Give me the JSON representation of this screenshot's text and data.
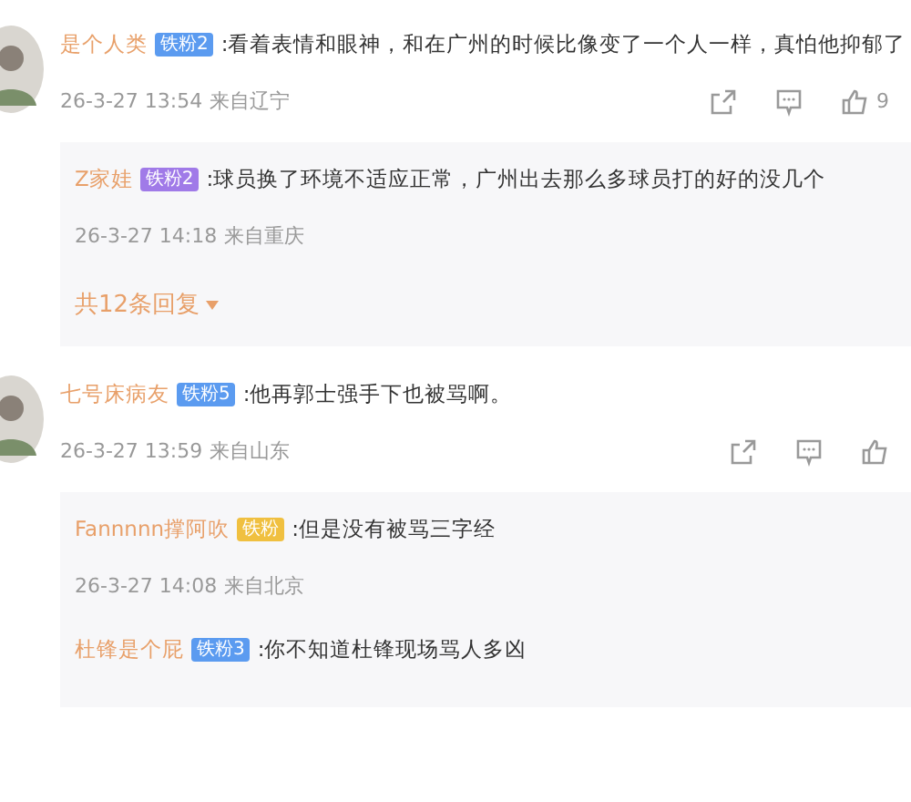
{
  "comments": [
    {
      "user": "是个人类",
      "badge": {
        "label": "铁粉2",
        "color": "#5b9bf0"
      },
      "text": ":看着表情和眼神，和在广州的时候比像变了一个人一样，真怕他抑郁了",
      "time": "26-3-27 13:54",
      "location": "来自辽宁",
      "likes": "9",
      "replies": [
        {
          "user": "Z家娃",
          "badge": {
            "label": "铁粉2",
            "color": "#a07ae8"
          },
          "text": ":球员换了环境不适应正常，广州出去那么多球员打的好的没几个",
          "time": "26-3-27 14:18",
          "location": "来自重庆"
        }
      ],
      "more_replies": "共12条回复"
    },
    {
      "user": "七号床病友",
      "badge": {
        "label": "铁粉5",
        "color": "#5b9bf0"
      },
      "text": ":他再郭士强手下也被骂啊。",
      "time": "26-3-27 13:59",
      "location": "来自山东",
      "replies": [
        {
          "user": "Fannnnn撑阿吹",
          "badge": {
            "label": "铁粉",
            "color": "#f0c040"
          },
          "text": ":但是没有被骂三字经",
          "time": "26-3-27 14:08",
          "location": "来自北京"
        },
        {
          "user": "杜锋是个屁",
          "badge": {
            "label": "铁粉3",
            "color": "#5b9bf0"
          },
          "text": ":你不知道杜锋现场骂人多凶"
        }
      ]
    }
  ]
}
